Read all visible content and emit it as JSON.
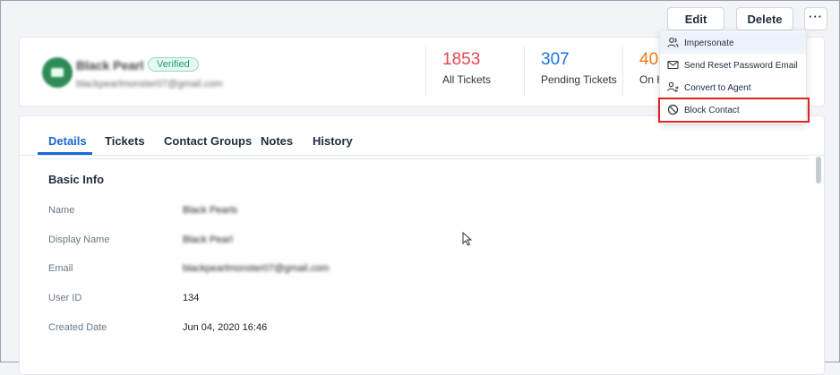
{
  "toolbar": {
    "edit_label": "Edit",
    "delete_label": "Delete",
    "more_label": "···"
  },
  "profile": {
    "name": "Black Pearl",
    "email": "blackpearlmonster07@gmail.com",
    "status_badge": "Verified",
    "stats": [
      {
        "value": "1853",
        "label": "All Tickets",
        "color": "#e5484d"
      },
      {
        "value": "307",
        "label": "Pending Tickets",
        "color": "#1a73e8"
      },
      {
        "value": "40",
        "label": "On H",
        "color": "#f07a1a"
      }
    ]
  },
  "dropdown": {
    "items": [
      {
        "label": "Impersonate",
        "icon": "users-icon"
      },
      {
        "label": "Send Reset Password Email",
        "icon": "mail-icon"
      },
      {
        "label": "Convert to Agent",
        "icon": "user-swap-icon"
      },
      {
        "label": "Block Contact",
        "icon": "block-icon"
      }
    ]
  },
  "tabs": [
    {
      "label": "Details",
      "active": true
    },
    {
      "label": "Tickets"
    },
    {
      "label": "Contact Groups"
    },
    {
      "label": "Notes"
    },
    {
      "label": "History"
    }
  ],
  "basic_info": {
    "title": "Basic Info",
    "fields": [
      {
        "label": "Name",
        "value": "Black Pearls"
      },
      {
        "label": "Display Name",
        "value": "Black Pearl"
      },
      {
        "label": "Email",
        "value": "blackpearlmonster07@gmail.com"
      },
      {
        "label": "User ID",
        "value": "134"
      },
      {
        "label": "Created Date",
        "value": "Jun 04, 2020 16:46"
      }
    ]
  },
  "colors": {
    "accent": "#1967d2",
    "highlight_box": "#e02424",
    "badge": "#1e9e7a"
  }
}
